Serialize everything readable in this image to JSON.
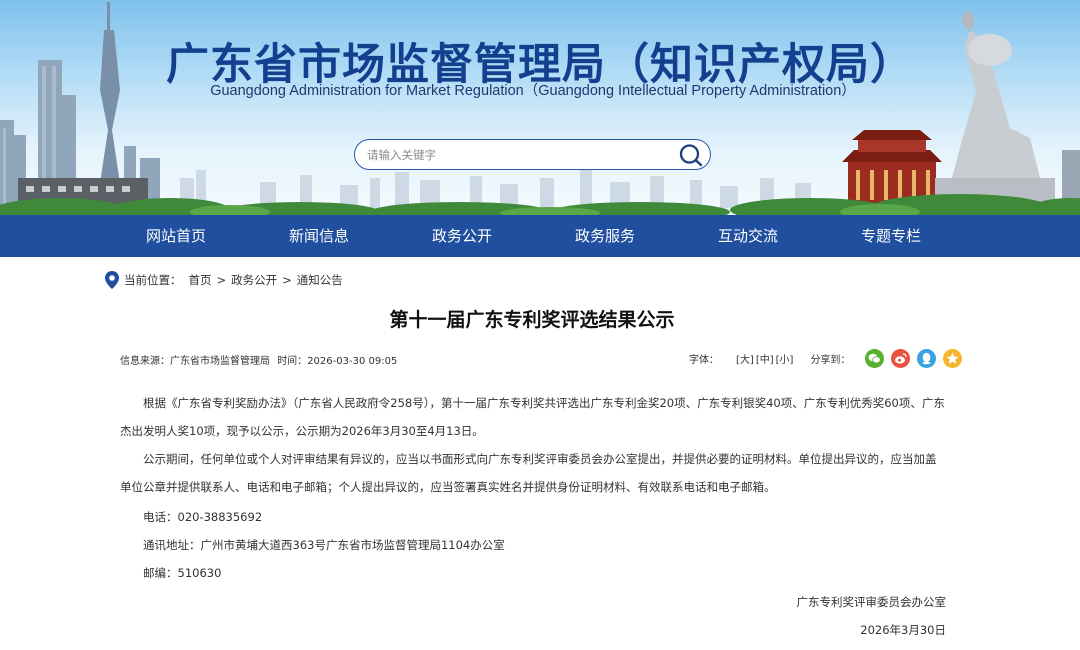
{
  "header": {
    "title": "广东省市场监督管理局（知识产权局）",
    "subtitle": "Guangdong Administration for Market Regulation（Guangdong Intellectual Property Administration）",
    "search": {
      "placeholder": "请输入关键字"
    }
  },
  "nav": {
    "items": [
      {
        "label": "网站首页"
      },
      {
        "label": "新闻信息"
      },
      {
        "label": "政务公开"
      },
      {
        "label": "政务服务"
      },
      {
        "label": "互动交流"
      },
      {
        "label": "专题专栏"
      }
    ],
    "color": "#1f4f9e"
  },
  "breadcrumb": {
    "label": "当前位置：",
    "items": [
      "首页",
      "政务公开",
      "通知公告"
    ],
    "separator": ">"
  },
  "article": {
    "title": "第十一届广东专利奖评选结果公示",
    "source_label": "信息来源：",
    "source": "广东省市场监督管理局",
    "time_label": "时间：",
    "time": "2026-03-30 09:05",
    "font_label": "字体：",
    "font_sizes": [
      "[大]",
      "[中]",
      "[小]"
    ],
    "share_label": "分享到：",
    "share_icons": [
      "wechat-icon",
      "weibo-icon",
      "qq-icon",
      "qzone-icon"
    ],
    "paragraph1": "根据《广东省专利奖励办法》（广东省人民政府令258号），第十一届广东专利奖共评选出广东专利金奖20项、广东专利银奖40项、广东专利优秀奖60项、广东杰出发明人奖10项，现予以公示，公示期为2026年3月30至4月13日。",
    "paragraph2": "公示期间，任何单位或个人对评审结果有异议的，应当以书面形式向广东专利奖评审委员会办公室提出，并提供必要的证明材料。单位提出异议的，应当加盖单位公章并提供联系人、电话和电子邮箱；个人提出异议的，应当签署真实姓名并提供身份证明材料、有效联系电话和电子邮箱。",
    "phone": "电话：020-38835692",
    "address": "通讯地址：广州市黄埔大道西363号广东省市场监督管理局1104办公室",
    "postcode": "邮编：510630",
    "signature": "广东专利奖评审委员会办公室",
    "date": "2026年3月30日"
  }
}
